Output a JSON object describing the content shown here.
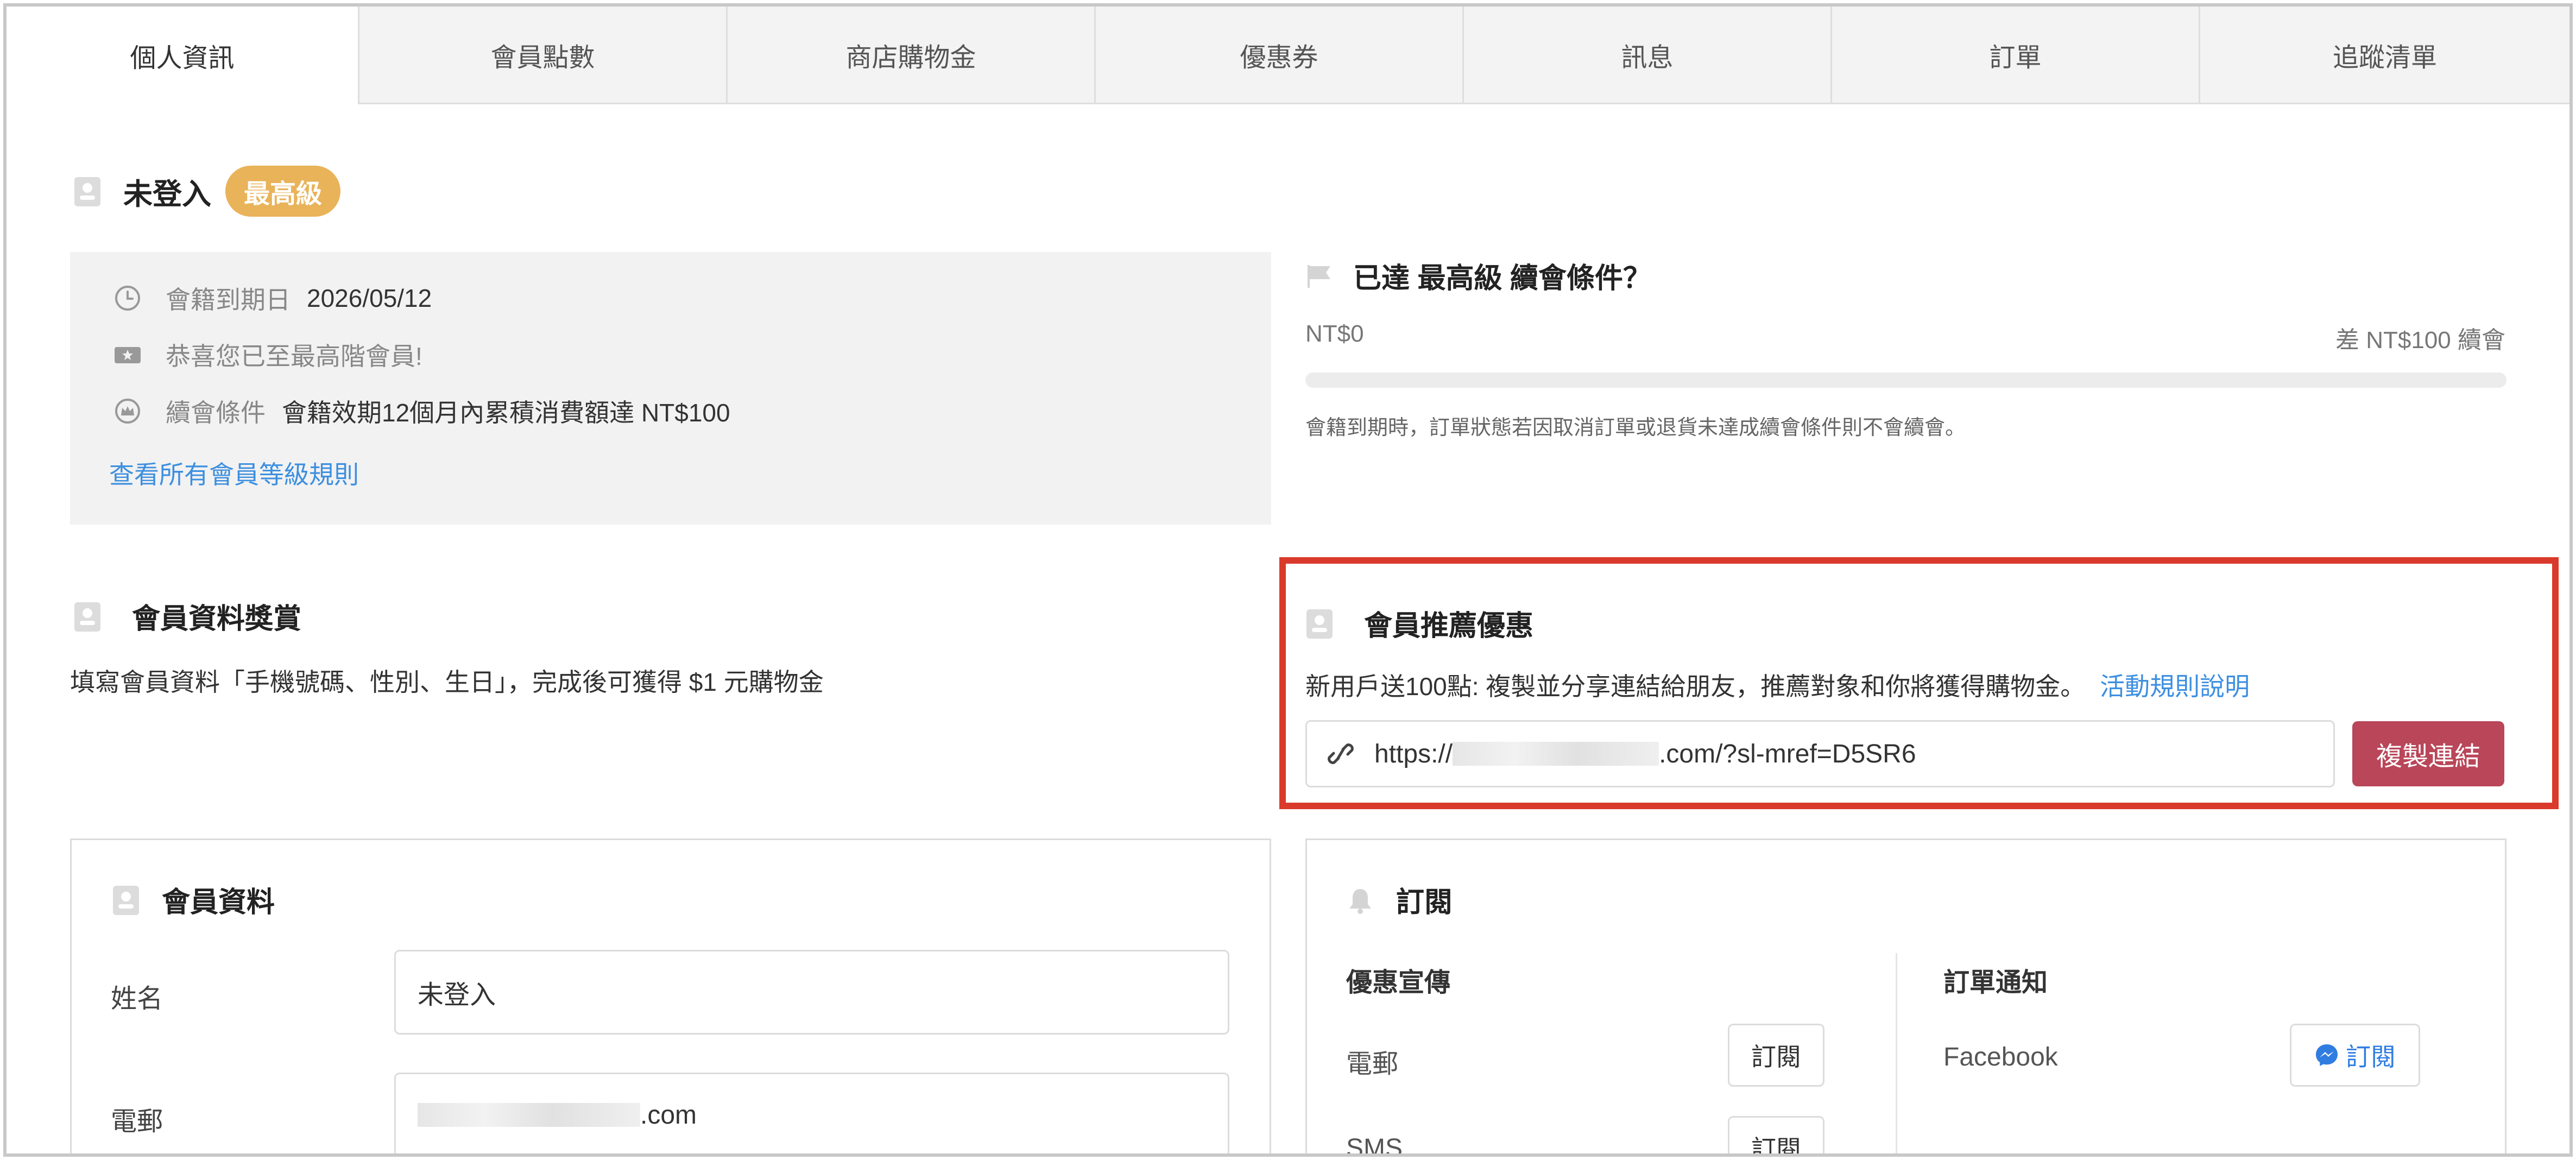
{
  "tabs": [
    {
      "label": "個人資訊",
      "active": true
    },
    {
      "label": "會員點數"
    },
    {
      "label": "商店購物金"
    },
    {
      "label": "優惠券"
    },
    {
      "label": "訊息"
    },
    {
      "label": "訂單"
    },
    {
      "label": "追蹤清單"
    }
  ],
  "user": {
    "name": "未登入",
    "tier": "最高級"
  },
  "membership": {
    "expiry_label": "會籍到期日",
    "expiry_value": "2026/05/12",
    "congrats": "恭喜您已至最高階會員!",
    "renew_label": "續會條件",
    "renew_value": "會籍效期12個月內累積消費額達 NT$100",
    "rules_link": "查看所有會員等級規則"
  },
  "renew": {
    "title": "已達 最高級 續會條件？",
    "current": "NT$0",
    "remaining": "差 NT$100 續會",
    "progress_fraction": 0,
    "note": "會籍到期時，訂單狀態若因取消訂單或退貨未達成續會條件則不會續會。"
  },
  "reward": {
    "title": "會員資料獎賞",
    "description": "填寫會員資料「手機號碼、性別、生日」，完成後可獲得 $1 元購物金"
  },
  "referral": {
    "title": "會員推薦優惠",
    "description": "新用戶送100點: 複製並分享連結給朋友，推薦對象和你將獲得購物金。",
    "rules_link": "活動規則說明",
    "url_prefix": "https://",
    "url_suffix": ".com/?sl-mref=D5SR6",
    "copy_button": "複製連結"
  },
  "profile": {
    "title": "會員資料",
    "name_label": "姓名",
    "name_value": "未登入",
    "email_label": "電郵",
    "email_suffix": ".com"
  },
  "subscription": {
    "title": "訂閱",
    "promo_title": "優惠宣傳",
    "email_label": "電郵",
    "sms_label": "SMS",
    "subscribe_label": "訂閱",
    "order_title": "訂單通知",
    "facebook_label": "Facebook"
  },
  "colors": {
    "tier_badge": "#e9b35a",
    "link": "#3d8fe0",
    "copy_button": "#b94659",
    "highlight_border": "#d93a2b"
  }
}
